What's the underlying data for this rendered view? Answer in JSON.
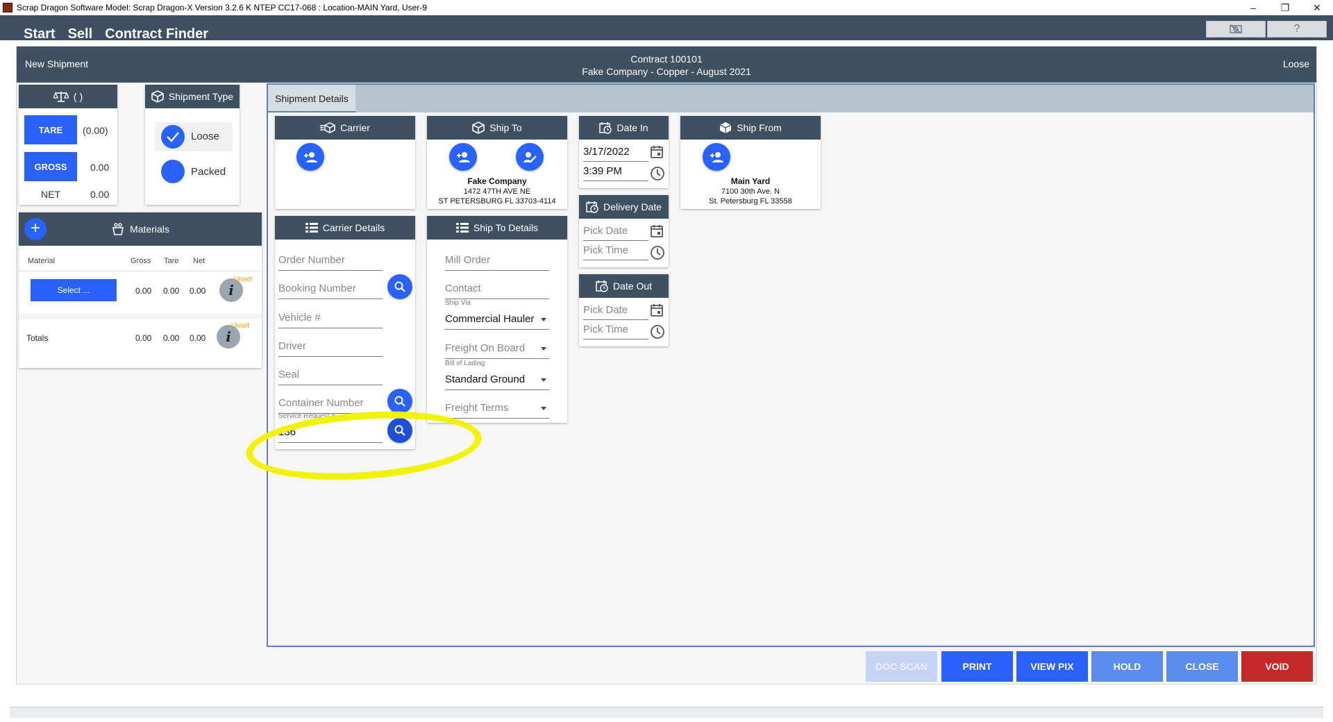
{
  "window": {
    "title": "Scrap Dragon Software Model: Scrap Dragon-X Version 3.2.6 K NTEP CC17-068 : Location-MAIN Yard, User-9",
    "controls": [
      "–",
      "❐",
      "✕"
    ]
  },
  "nav": {
    "items": [
      "Start",
      "Sell",
      "Contract Finder"
    ]
  },
  "top_buttons": {
    "camera_icon": "camera-off-icon",
    "help": "?"
  },
  "header": {
    "left": "New Shipment",
    "contract": "Contract 100101",
    "contract_desc": "Fake Company - Copper - August 2021",
    "right": "Loose"
  },
  "weigh": {
    "scale_label": "( )",
    "tare_button": "TARE",
    "tare_value": "(0.00)",
    "gross_button": "GROSS",
    "gross_value": "0.00",
    "net_label": "NET",
    "net_value": "0.00"
  },
  "shipment_type": {
    "title": "Shipment Type",
    "options": [
      "Loose",
      "Packed"
    ],
    "selected": "Loose"
  },
  "materials": {
    "title": "Materials",
    "columns": [
      "Material",
      "Gross",
      "Tare",
      "Net"
    ],
    "row": {
      "select_label": "Select ...",
      "gross": "0.00",
      "tare": "0.00",
      "net": "0.00",
      "status": "Unset"
    },
    "totals": {
      "label": "Totals",
      "gross": "0.00",
      "tare": "0.00",
      "net": "0.00",
      "status": "Unset"
    }
  },
  "shipment_details": {
    "tab": "Shipment Details",
    "carrier": {
      "title": "Carrier"
    },
    "ship_to": {
      "title": "Ship To",
      "name": "Fake Company",
      "address1": "1472 47TH AVE NE",
      "address2": "ST PETERSBURG FL 33703-4114"
    },
    "date_in": {
      "title": "Date In",
      "date": "3/17/2022",
      "time": "3:39 PM"
    },
    "delivery_date": {
      "title": "Delivery Date",
      "date_placeholder": "Pick Date",
      "time_placeholder": "Pick Time"
    },
    "date_out": {
      "title": "Date Out",
      "date_placeholder": "Pick Date",
      "time_placeholder": "Pick Time"
    },
    "ship_from": {
      "title": "Ship From",
      "name": "Main Yard",
      "address1": "7100 30th Ave. N",
      "address2": "St. Petersburg FL 33558"
    },
    "carrier_details": {
      "title": "Carrier Details",
      "order_number": "Order Number",
      "booking_number": "Booking Number",
      "vehicle": "Vehicle #",
      "driver": "Driver",
      "seal": "Seal",
      "container_number": "Container Number",
      "service_request_label": "Service Request #",
      "service_request_value": "136"
    },
    "ship_to_details": {
      "title": "Ship To Details",
      "mill_order": "Mill Order",
      "contact": "Contact",
      "ship_via_label": "Ship Via",
      "ship_via_value": "Commercial Hauler",
      "freight_on_board": "Freight On Board",
      "bill_of_lading_label": "Bill of Lading",
      "bill_of_lading_value": "Standard Ground",
      "freight_terms": "Freight Terms"
    }
  },
  "actions": {
    "doc_scan": "DOC SCAN",
    "print": "PRINT",
    "view_pix": "VIEW PIX",
    "hold": "HOLD",
    "close": "CLOSE",
    "void": "VOID"
  },
  "colors": {
    "header_bg": "#3f5161",
    "primary": "#2962ff",
    "void": "#c62828",
    "hold_close": "#5b8def",
    "doc_scan_disabled": "#c5d3f5",
    "annotation": "#f2f208"
  }
}
